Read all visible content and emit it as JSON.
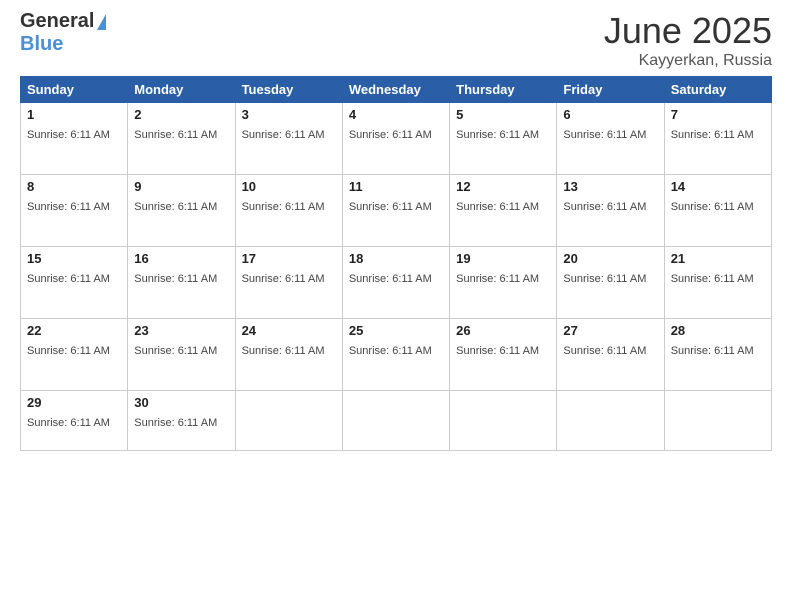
{
  "header": {
    "logo_general": "General",
    "logo_blue": "Blue",
    "month_title": "June 2025",
    "location": "Kayyerkan, Russia"
  },
  "calendar": {
    "days_of_week": [
      "Sunday",
      "Monday",
      "Tuesday",
      "Wednesday",
      "Thursday",
      "Friday",
      "Saturday"
    ],
    "sunrise_text": "Sunrise: 6:11 AM",
    "weeks": [
      [
        {
          "day": "1",
          "sunrise": "Sunrise: 6:11 AM"
        },
        {
          "day": "2",
          "sunrise": "Sunrise: 6:11 AM"
        },
        {
          "day": "3",
          "sunrise": "Sunrise: 6:11 AM"
        },
        {
          "day": "4",
          "sunrise": "Sunrise: 6:11 AM"
        },
        {
          "day": "5",
          "sunrise": "Sunrise: 6:11 AM"
        },
        {
          "day": "6",
          "sunrise": "Sunrise: 6:11 AM"
        },
        {
          "day": "7",
          "sunrise": "Sunrise: 6:11 AM"
        }
      ],
      [
        {
          "day": "8",
          "sunrise": "Sunrise: 6:11 AM"
        },
        {
          "day": "9",
          "sunrise": "Sunrise: 6:11 AM"
        },
        {
          "day": "10",
          "sunrise": "Sunrise: 6:11 AM"
        },
        {
          "day": "11",
          "sunrise": "Sunrise: 6:11 AM"
        },
        {
          "day": "12",
          "sunrise": "Sunrise: 6:11 AM"
        },
        {
          "day": "13",
          "sunrise": "Sunrise: 6:11 AM"
        },
        {
          "day": "14",
          "sunrise": "Sunrise: 6:11 AM"
        }
      ],
      [
        {
          "day": "15",
          "sunrise": "Sunrise: 6:11 AM"
        },
        {
          "day": "16",
          "sunrise": "Sunrise: 6:11 AM"
        },
        {
          "day": "17",
          "sunrise": "Sunrise: 6:11 AM"
        },
        {
          "day": "18",
          "sunrise": "Sunrise: 6:11 AM"
        },
        {
          "day": "19",
          "sunrise": "Sunrise: 6:11 AM"
        },
        {
          "day": "20",
          "sunrise": "Sunrise: 6:11 AM"
        },
        {
          "day": "21",
          "sunrise": "Sunrise: 6:11 AM"
        }
      ],
      [
        {
          "day": "22",
          "sunrise": "Sunrise: 6:11 AM"
        },
        {
          "day": "23",
          "sunrise": "Sunrise: 6:11 AM"
        },
        {
          "day": "24",
          "sunrise": "Sunrise: 6:11 AM"
        },
        {
          "day": "25",
          "sunrise": "Sunrise: 6:11 AM"
        },
        {
          "day": "26",
          "sunrise": "Sunrise: 6:11 AM"
        },
        {
          "day": "27",
          "sunrise": "Sunrise: 6:11 AM"
        },
        {
          "day": "28",
          "sunrise": "Sunrise: 6:11 AM"
        }
      ],
      [
        {
          "day": "29",
          "sunrise": "Sunrise: 6:11 AM"
        },
        {
          "day": "30",
          "sunrise": "Sunrise: 6:11 AM"
        },
        {
          "day": "",
          "sunrise": ""
        },
        {
          "day": "",
          "sunrise": ""
        },
        {
          "day": "",
          "sunrise": ""
        },
        {
          "day": "",
          "sunrise": ""
        },
        {
          "day": "",
          "sunrise": ""
        }
      ]
    ]
  }
}
